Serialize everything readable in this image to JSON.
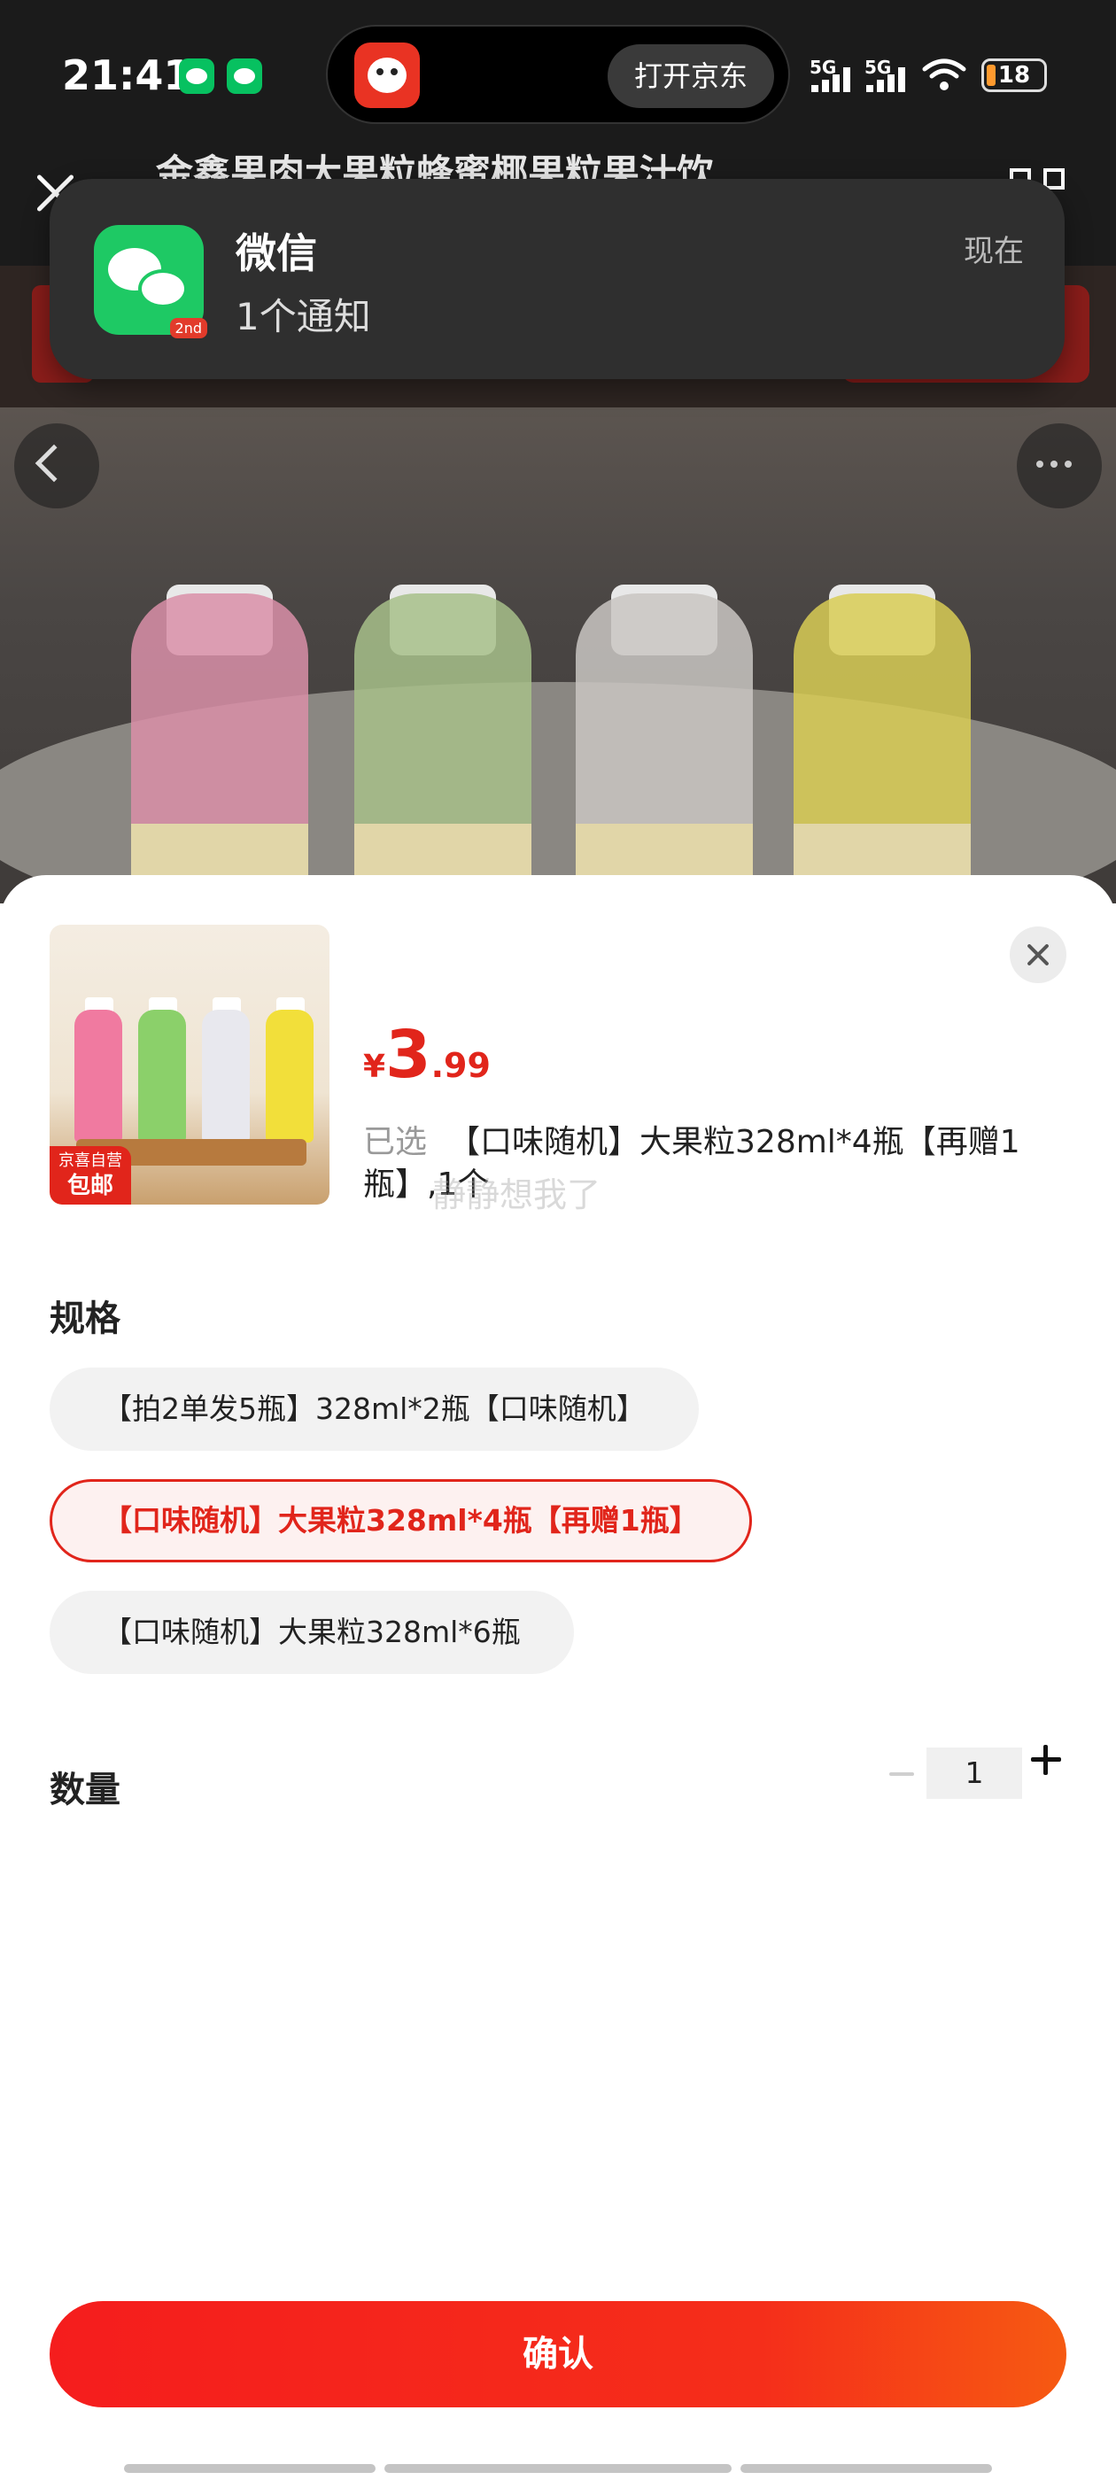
{
  "status_bar": {
    "time": "21:41",
    "battery": "18",
    "signal_1": "5G",
    "signal_2": "5G"
  },
  "island": {
    "open_button": "打开京东"
  },
  "page": {
    "title": "金鑫果肉大果粒蜂蜜椰果粒果汁饮…"
  },
  "notification": {
    "app_name": "微信",
    "message": "1个通知",
    "time": "现在",
    "badge": "2nd"
  },
  "product": {
    "price_currency": "¥",
    "price_integer": "3",
    "price_decimal": ".99",
    "badge_line1": "京喜自营",
    "badge_line2": "包邮",
    "selected_prefix": "已选",
    "selected_text": "【口味随机】大果粒328ml*4瓶【再赠1瓶】,1个",
    "watermark": "静静想我了"
  },
  "spec": {
    "title": "规格",
    "options": [
      {
        "label": "【拍2单发5瓶】328ml*2瓶【口味随机】",
        "selected": false
      },
      {
        "label": "【口味随机】大果粒328ml*4瓶【再赠1瓶】",
        "selected": true
      },
      {
        "label": "【口味随机】大果粒328ml*6瓶",
        "selected": false
      }
    ]
  },
  "quantity": {
    "title": "数量",
    "value": "1"
  },
  "confirm_label": "确认",
  "colors": {
    "accent": "#e1251b",
    "wechat_green": "#1ec964",
    "chip_bg": "#f2f2f2"
  }
}
